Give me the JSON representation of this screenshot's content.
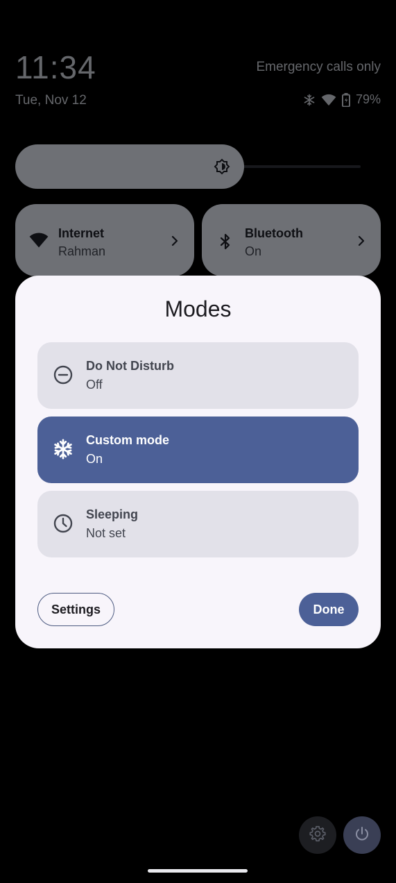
{
  "status_bar": {
    "time": "11:34",
    "date": "Tue, Nov 12",
    "carrier": "Emergency calls only",
    "battery_percent": "79%",
    "icons": [
      "snowflake-icon",
      "wifi-icon",
      "battery-icon"
    ]
  },
  "brightness": {
    "level": 0.6
  },
  "tiles": [
    {
      "title": "Internet",
      "subtitle": "Rahman",
      "icon": "wifi-icon"
    },
    {
      "title": "Bluetooth",
      "subtitle": "On",
      "icon": "bluetooth-icon"
    }
  ],
  "dialog": {
    "title": "Modes",
    "modes": [
      {
        "title": "Do Not Disturb",
        "status": "Off",
        "icon": "minus-circle-icon",
        "active": false
      },
      {
        "title": "Custom mode",
        "status": "On",
        "icon": "snowflake-icon",
        "active": true
      },
      {
        "title": "Sleeping",
        "status": "Not set",
        "icon": "clock-icon",
        "active": false
      }
    ],
    "settings_label": "Settings",
    "done_label": "Done"
  },
  "colors": {
    "accent": "#4c6097",
    "dialog_bg": "#f8f5fb",
    "mode_inactive": "#e2e1e9"
  }
}
